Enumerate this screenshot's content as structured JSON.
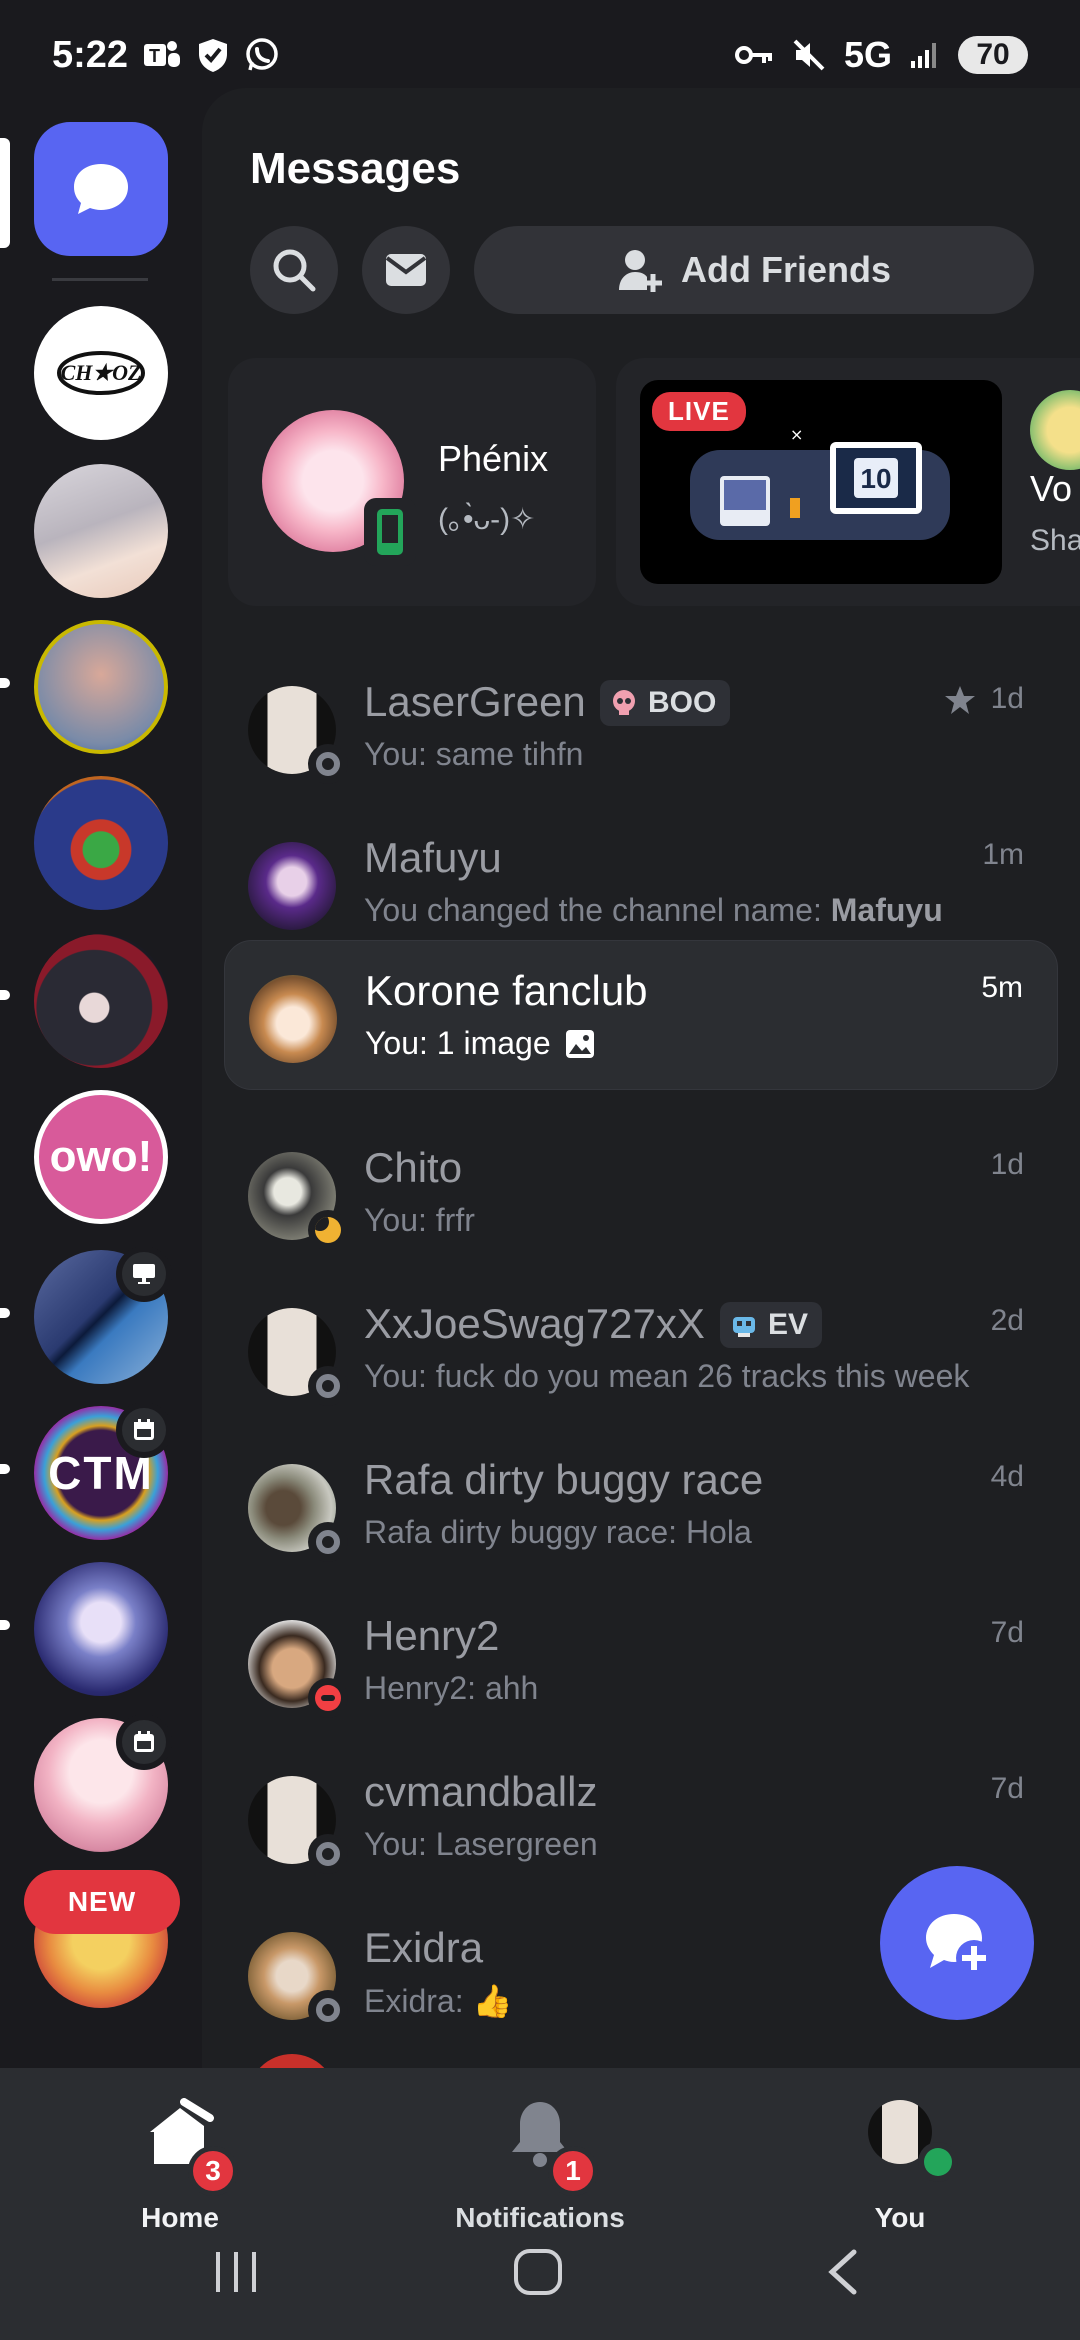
{
  "status_bar": {
    "time": "5:22",
    "network": "5G",
    "battery": "70"
  },
  "sidebar": {
    "new_label": "NEW"
  },
  "header": {
    "title": "Messages",
    "add_friends_label": "Add Friends"
  },
  "active_now": {
    "user_card": {
      "name": "Phénix",
      "status": "(｡•̀ᴗ-)✧"
    },
    "live_card": {
      "badge": "LIVE",
      "name_partial": "Vo",
      "sub_partial": "Sha"
    }
  },
  "dms": [
    {
      "name": "LaserGreen",
      "tag": "BOO",
      "preview": "You: same tihfn",
      "time": "1d",
      "starred": true,
      "status": "offline"
    },
    {
      "name": "Mafuyu",
      "preview_prefix": "You changed the channel name: ",
      "preview_bold": "Mafuyu",
      "time": "1m",
      "status": "none"
    },
    {
      "name": "Korone fanclub",
      "preview": "You: 1 image",
      "time": "5m",
      "status": "none",
      "active": true
    },
    {
      "name": "Chito",
      "preview": "You: frfr",
      "time": "1d",
      "status": "idle"
    },
    {
      "name": "XxJoeSwag727xX",
      "tag": "EV",
      "preview": "You: fuck do you mean 26 tracks this week",
      "time": "2d",
      "status": "offline"
    },
    {
      "name": "Rafa dirty  buggy race",
      "preview": "Rafa dirty  buggy race: Hola",
      "time": "4d",
      "status": "offline"
    },
    {
      "name": "Henry2",
      "preview": "Henry2: ahh",
      "time": "7d",
      "status": "dnd"
    },
    {
      "name": "cvmandballz",
      "preview": "You: Lasergreen",
      "time": "7d",
      "status": "offline"
    },
    {
      "name": "Exidra",
      "preview": "Exidra: 👍",
      "time": "",
      "status": "offline"
    }
  ],
  "bottom_nav": {
    "home_label": "Home",
    "home_badge": "3",
    "notifications_label": "Notifications",
    "notifications_badge": "1",
    "you_label": "You"
  },
  "colors": {
    "accent": "#5865f2",
    "danger": "#e2363f",
    "online": "#23a55a",
    "idle": "#f0b232",
    "dnd": "#f23f43"
  }
}
